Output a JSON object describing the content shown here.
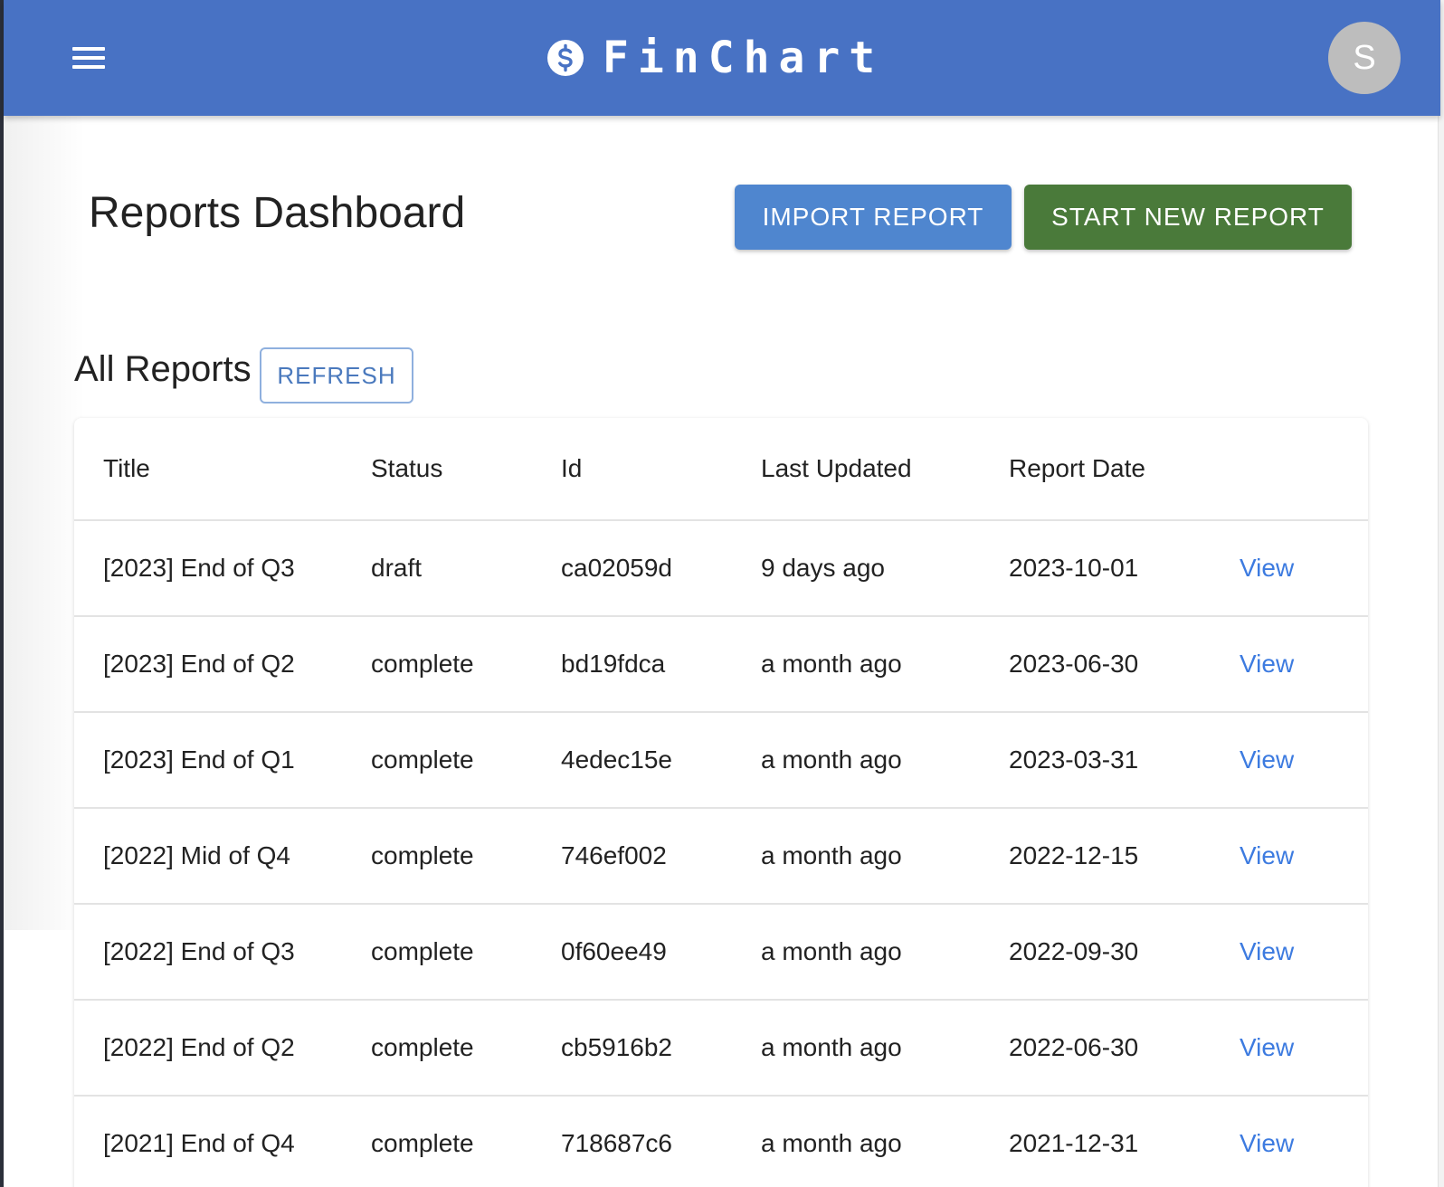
{
  "appbar": {
    "brand": "FinChart",
    "brand_icon": "dollar-circle-icon",
    "menu_icon": "hamburger-menu-icon",
    "avatar_initial": "S",
    "color": "#4872c4"
  },
  "header": {
    "title": "Reports Dashboard",
    "import_label": "IMPORT REPORT",
    "start_label": "START NEW REPORT",
    "import_color": "#4f86cf",
    "start_color": "#4a7a3a"
  },
  "reports": {
    "section_title": "All Reports",
    "refresh_label": "REFRESH",
    "columns": [
      "Title",
      "Status",
      "Id",
      "Last Updated",
      "Report Date",
      ""
    ],
    "rows": [
      {
        "title": "[2023] End of Q3",
        "status": "draft",
        "id": "ca02059d",
        "updated": "9 days ago",
        "date": "2023-10-01",
        "action": "View"
      },
      {
        "title": "[2023] End of Q2",
        "status": "complete",
        "id": "bd19fdca",
        "updated": "a month ago",
        "date": "2023-06-30",
        "action": "View"
      },
      {
        "title": "[2023] End of Q1",
        "status": "complete",
        "id": "4edec15e",
        "updated": "a month ago",
        "date": "2023-03-31",
        "action": "View"
      },
      {
        "title": "[2022] Mid of Q4",
        "status": "complete",
        "id": "746ef002",
        "updated": "a month ago",
        "date": "2022-12-15",
        "action": "View"
      },
      {
        "title": "[2022] End of Q3",
        "status": "complete",
        "id": "0f60ee49",
        "updated": "a month ago",
        "date": "2022-09-30",
        "action": "View"
      },
      {
        "title": "[2022] End of Q2",
        "status": "complete",
        "id": "cb5916b2",
        "updated": "a month ago",
        "date": "2022-06-30",
        "action": "View"
      },
      {
        "title": "[2021] End of Q4",
        "status": "complete",
        "id": "718687c6",
        "updated": "a month ago",
        "date": "2021-12-31",
        "action": "View"
      }
    ]
  }
}
